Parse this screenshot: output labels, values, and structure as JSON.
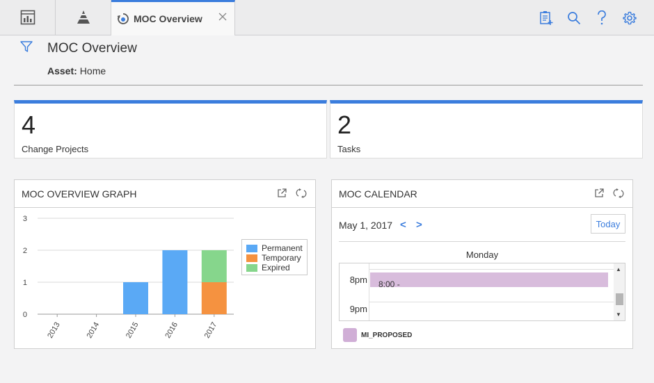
{
  "tabs": {
    "active_label": "MOC Overview",
    "icons": [
      "dashboard-icon",
      "pyramid-icon"
    ]
  },
  "toolbar": {
    "icons": [
      "notes-add-icon",
      "search-icon",
      "help-icon",
      "settings-icon"
    ]
  },
  "header": {
    "title": "MOC Overview",
    "asset_label": "Asset:",
    "asset_value": "Home"
  },
  "kpis": [
    {
      "value": "4",
      "label": "Change Projects"
    },
    {
      "value": "2",
      "label": "Tasks"
    }
  ],
  "graph_panel": {
    "title": "MOC OVERVIEW GRAPH"
  },
  "chart_data": {
    "type": "bar",
    "stacked": true,
    "categories": [
      "2013",
      "2014",
      "2015",
      "2016",
      "2017"
    ],
    "series": [
      {
        "name": "Permanent",
        "values": [
          0,
          0,
          1,
          2,
          0
        ],
        "color": "#5aa9f5"
      },
      {
        "name": "Temporary",
        "values": [
          0,
          0,
          0,
          0,
          1
        ],
        "color": "#f59240"
      },
      {
        "name": "Expired",
        "values": [
          0,
          0,
          0,
          0,
          1
        ],
        "color": "#86d68c"
      }
    ],
    "y_ticks": [
      "0",
      "1",
      "2",
      "3"
    ],
    "ylim": [
      0,
      3
    ],
    "grid": true,
    "legend_position": "right"
  },
  "calendar_panel": {
    "title": "MOC CALENDAR",
    "date": "May 1, 2017",
    "prev": "<",
    "next": ">",
    "today_label": "Today",
    "day_label": "Monday",
    "hours": [
      "8pm",
      "9pm"
    ],
    "event_text": "8:00 -",
    "legend_label": "MI_PROPOSED",
    "event_color": "#d8bcdc"
  }
}
